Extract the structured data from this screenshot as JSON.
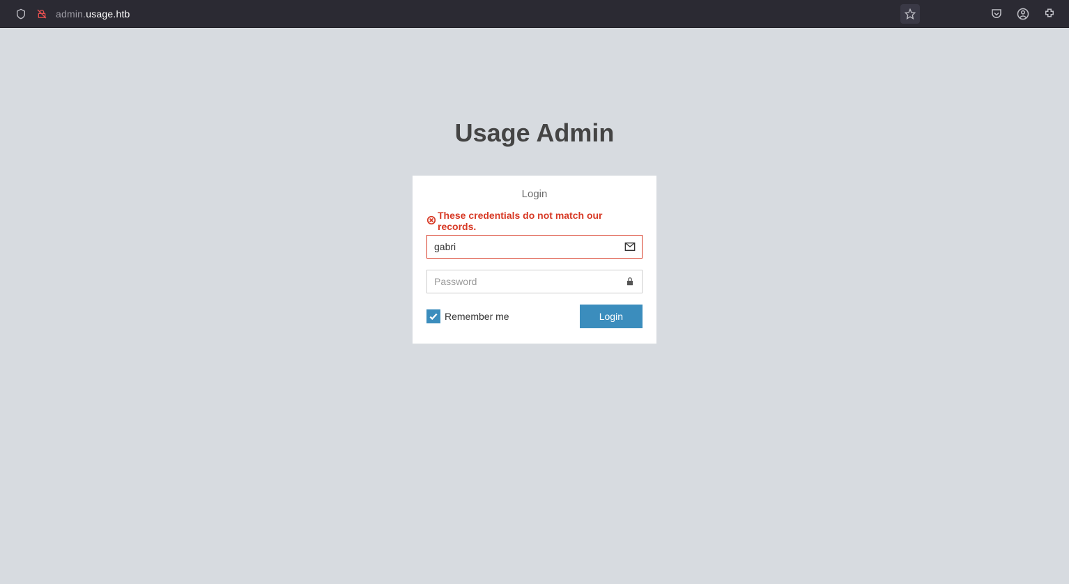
{
  "browser": {
    "url_subdomain": "admin.",
    "url_host": "usage.htb"
  },
  "page": {
    "title": "Usage Admin"
  },
  "login": {
    "header": "Login",
    "error": "These credentials do not match our records.",
    "username_value": "gabri",
    "password_placeholder": "Password",
    "remember_label": "Remember me",
    "remember_checked": true,
    "submit_label": "Login"
  }
}
